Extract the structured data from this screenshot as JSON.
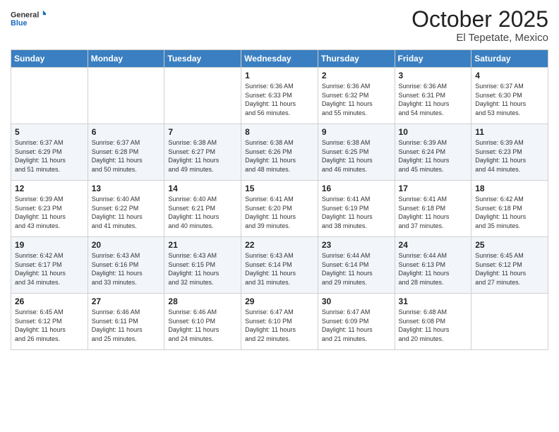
{
  "logo": {
    "general": "General",
    "blue": "Blue"
  },
  "title": {
    "month": "October 2025",
    "location": "El Tepetate, Mexico"
  },
  "weekdays": [
    "Sunday",
    "Monday",
    "Tuesday",
    "Wednesday",
    "Thursday",
    "Friday",
    "Saturday"
  ],
  "weeks": [
    [
      {
        "day": "",
        "info": ""
      },
      {
        "day": "",
        "info": ""
      },
      {
        "day": "",
        "info": ""
      },
      {
        "day": "1",
        "info": "Sunrise: 6:36 AM\nSunset: 6:33 PM\nDaylight: 11 hours\nand 56 minutes."
      },
      {
        "day": "2",
        "info": "Sunrise: 6:36 AM\nSunset: 6:32 PM\nDaylight: 11 hours\nand 55 minutes."
      },
      {
        "day": "3",
        "info": "Sunrise: 6:36 AM\nSunset: 6:31 PM\nDaylight: 11 hours\nand 54 minutes."
      },
      {
        "day": "4",
        "info": "Sunrise: 6:37 AM\nSunset: 6:30 PM\nDaylight: 11 hours\nand 53 minutes."
      }
    ],
    [
      {
        "day": "5",
        "info": "Sunrise: 6:37 AM\nSunset: 6:29 PM\nDaylight: 11 hours\nand 51 minutes."
      },
      {
        "day": "6",
        "info": "Sunrise: 6:37 AM\nSunset: 6:28 PM\nDaylight: 11 hours\nand 50 minutes."
      },
      {
        "day": "7",
        "info": "Sunrise: 6:38 AM\nSunset: 6:27 PM\nDaylight: 11 hours\nand 49 minutes."
      },
      {
        "day": "8",
        "info": "Sunrise: 6:38 AM\nSunset: 6:26 PM\nDaylight: 11 hours\nand 48 minutes."
      },
      {
        "day": "9",
        "info": "Sunrise: 6:38 AM\nSunset: 6:25 PM\nDaylight: 11 hours\nand 46 minutes."
      },
      {
        "day": "10",
        "info": "Sunrise: 6:39 AM\nSunset: 6:24 PM\nDaylight: 11 hours\nand 45 minutes."
      },
      {
        "day": "11",
        "info": "Sunrise: 6:39 AM\nSunset: 6:23 PM\nDaylight: 11 hours\nand 44 minutes."
      }
    ],
    [
      {
        "day": "12",
        "info": "Sunrise: 6:39 AM\nSunset: 6:23 PM\nDaylight: 11 hours\nand 43 minutes."
      },
      {
        "day": "13",
        "info": "Sunrise: 6:40 AM\nSunset: 6:22 PM\nDaylight: 11 hours\nand 41 minutes."
      },
      {
        "day": "14",
        "info": "Sunrise: 6:40 AM\nSunset: 6:21 PM\nDaylight: 11 hours\nand 40 minutes."
      },
      {
        "day": "15",
        "info": "Sunrise: 6:41 AM\nSunset: 6:20 PM\nDaylight: 11 hours\nand 39 minutes."
      },
      {
        "day": "16",
        "info": "Sunrise: 6:41 AM\nSunset: 6:19 PM\nDaylight: 11 hours\nand 38 minutes."
      },
      {
        "day": "17",
        "info": "Sunrise: 6:41 AM\nSunset: 6:18 PM\nDaylight: 11 hours\nand 37 minutes."
      },
      {
        "day": "18",
        "info": "Sunrise: 6:42 AM\nSunset: 6:18 PM\nDaylight: 11 hours\nand 35 minutes."
      }
    ],
    [
      {
        "day": "19",
        "info": "Sunrise: 6:42 AM\nSunset: 6:17 PM\nDaylight: 11 hours\nand 34 minutes."
      },
      {
        "day": "20",
        "info": "Sunrise: 6:43 AM\nSunset: 6:16 PM\nDaylight: 11 hours\nand 33 minutes."
      },
      {
        "day": "21",
        "info": "Sunrise: 6:43 AM\nSunset: 6:15 PM\nDaylight: 11 hours\nand 32 minutes."
      },
      {
        "day": "22",
        "info": "Sunrise: 6:43 AM\nSunset: 6:14 PM\nDaylight: 11 hours\nand 31 minutes."
      },
      {
        "day": "23",
        "info": "Sunrise: 6:44 AM\nSunset: 6:14 PM\nDaylight: 11 hours\nand 29 minutes."
      },
      {
        "day": "24",
        "info": "Sunrise: 6:44 AM\nSunset: 6:13 PM\nDaylight: 11 hours\nand 28 minutes."
      },
      {
        "day": "25",
        "info": "Sunrise: 6:45 AM\nSunset: 6:12 PM\nDaylight: 11 hours\nand 27 minutes."
      }
    ],
    [
      {
        "day": "26",
        "info": "Sunrise: 6:45 AM\nSunset: 6:12 PM\nDaylight: 11 hours\nand 26 minutes."
      },
      {
        "day": "27",
        "info": "Sunrise: 6:46 AM\nSunset: 6:11 PM\nDaylight: 11 hours\nand 25 minutes."
      },
      {
        "day": "28",
        "info": "Sunrise: 6:46 AM\nSunset: 6:10 PM\nDaylight: 11 hours\nand 24 minutes."
      },
      {
        "day": "29",
        "info": "Sunrise: 6:47 AM\nSunset: 6:10 PM\nDaylight: 11 hours\nand 22 minutes."
      },
      {
        "day": "30",
        "info": "Sunrise: 6:47 AM\nSunset: 6:09 PM\nDaylight: 11 hours\nand 21 minutes."
      },
      {
        "day": "31",
        "info": "Sunrise: 6:48 AM\nSunset: 6:08 PM\nDaylight: 11 hours\nand 20 minutes."
      },
      {
        "day": "",
        "info": ""
      }
    ]
  ]
}
